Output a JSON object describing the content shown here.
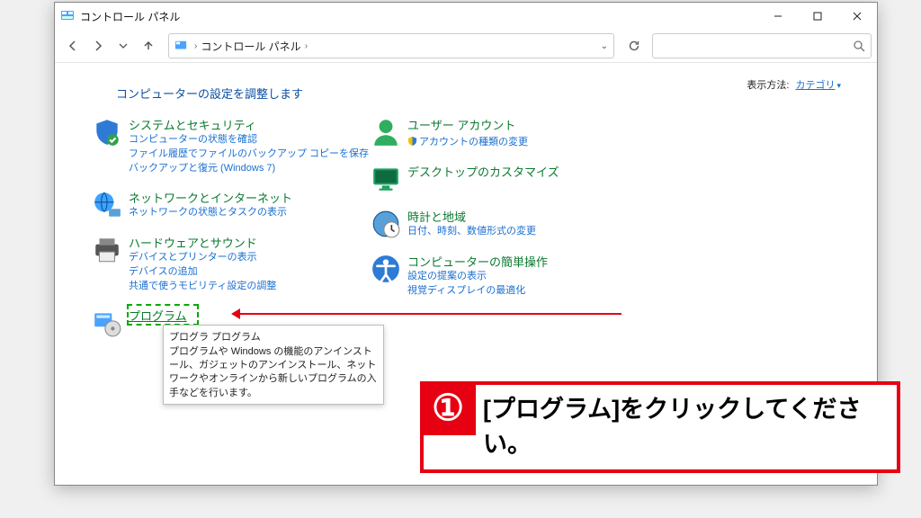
{
  "window": {
    "title": "コントロール パネル"
  },
  "breadcrumb": {
    "root": "コントロール パネル"
  },
  "heading": "コンピューターの設定を調整します",
  "view": {
    "label": "表示方法:",
    "value": "カテゴリ"
  },
  "left": {
    "sys": {
      "title": "システムとセキュリティ",
      "s1": "コンピューターの状態を確認",
      "s2": "ファイル履歴でファイルのバックアップ コピーを保存",
      "s3": "バックアップと復元 (Windows 7)"
    },
    "net": {
      "title": "ネットワークとインターネット",
      "s1": "ネットワークの状態とタスクの表示"
    },
    "hw": {
      "title": "ハードウェアとサウンド",
      "s1": "デバイスとプリンターの表示",
      "s2": "デバイスの追加",
      "s3": "共通で使うモビリティ設定の調整"
    },
    "prog": {
      "title": "プログラム",
      "sub": "プログラ プログラム",
      "tt_body": "プログラムや Windows の機能のアンインストール、ガジェットのアンインストール、ネットワークやオンラインから新しいプログラムの入手などを行います。"
    }
  },
  "right": {
    "user": {
      "title": "ユーザー アカウント",
      "s1": "アカウントの種類の変更"
    },
    "desk": {
      "title": "デスクトップのカスタマイズ"
    },
    "clock": {
      "title": "時計と地域",
      "s1": "日付、時刻、数値形式の変更"
    },
    "ease": {
      "title": "コンピューターの簡単操作",
      "s1": "設定の提案の表示",
      "s2": "視覚ディスプレイの最適化"
    }
  },
  "annotation": {
    "num": "①",
    "text": "[プログラム]をクリックしてください。"
  }
}
